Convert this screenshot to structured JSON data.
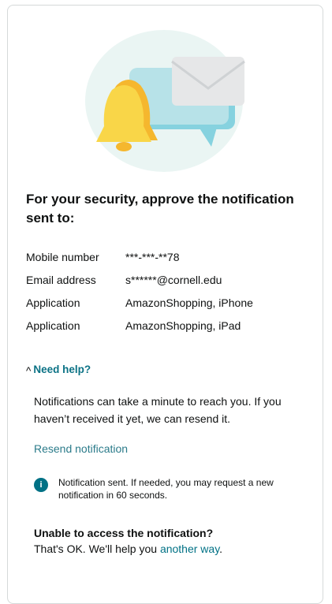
{
  "heading": "For your security, approve the notification sent to:",
  "details": [
    {
      "label": "Mobile number",
      "value": "***-***-**78"
    },
    {
      "label": "Email address",
      "value": "s******@cornell.edu"
    },
    {
      "label": "Application",
      "value": "AmazonShopping, iPhone"
    },
    {
      "label": "Application",
      "value": "AmazonShopping, iPad"
    }
  ],
  "help": {
    "caret": "^",
    "label": "Need help?"
  },
  "help_text": "Notifications can take a minute to reach you. If you haven’t received it yet, we can resend it.",
  "resend_label": "Resend notification",
  "info": {
    "icon": "info-icon",
    "text": "Notification sent. If needed, you may request a new notification in 60 seconds."
  },
  "unable": {
    "title": "Unable to access the notification?",
    "text_prefix": "That's OK. We'll help you ",
    "link": "another way",
    "text_suffix": "."
  },
  "colors": {
    "link": "#007185",
    "border": "#d5d9d9",
    "bell": "#f7d34a",
    "bubble": "#a8dde8"
  }
}
